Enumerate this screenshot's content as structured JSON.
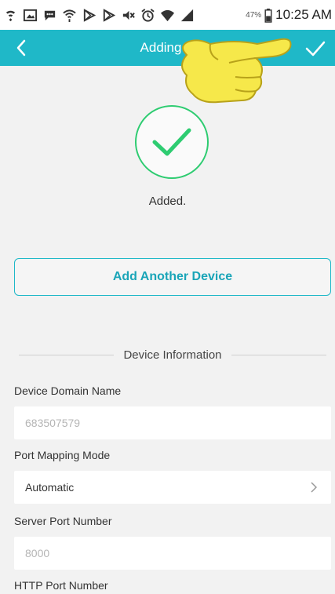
{
  "status_bar": {
    "icons": [
      "nfc-icon",
      "gallery-icon",
      "chat-icon",
      "hotspot-icon",
      "play-store-icon",
      "play-store-icon",
      "mute-icon",
      "alarm-icon",
      "wifi-icon",
      "signal-icon"
    ],
    "battery": "47%",
    "time": "10:25 AM"
  },
  "header": {
    "title": "Adding C",
    "back_icon": "chevron-left-icon",
    "confirm_icon": "checkmark-icon",
    "background": "#1fb8c8"
  },
  "success": {
    "icon": "checkmark-circle-icon",
    "message": "Added.",
    "color": "#2ecc71"
  },
  "actions": {
    "add_another_label": "Add Another Device"
  },
  "device_info": {
    "section_title": "Device Information",
    "fields": [
      {
        "label": "Device Domain Name",
        "value": "683507579",
        "type": "readonly"
      },
      {
        "label": "Port Mapping Mode",
        "value": "Automatic",
        "type": "select"
      },
      {
        "label": "Server Port Number",
        "value": "8000",
        "type": "readonly"
      },
      {
        "label": "HTTP Port Number",
        "value": "",
        "type": "readonly"
      }
    ]
  },
  "colors": {
    "accent": "#1fb8c8",
    "success": "#2ecc71",
    "background": "#f2f2f2"
  }
}
